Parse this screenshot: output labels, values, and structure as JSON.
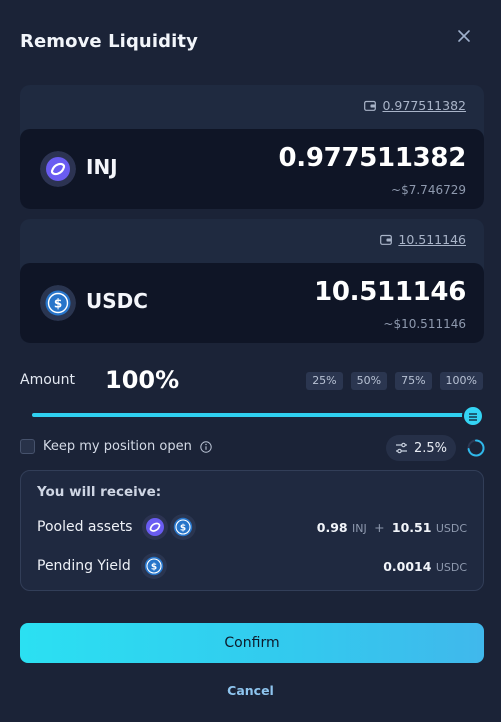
{
  "modal": {
    "title": "Remove Liquidity"
  },
  "tokens": [
    {
      "symbol": "INJ",
      "balance": "0.977511382",
      "amount": "0.977511382",
      "usd_value": "~$7.746729",
      "icon": "injective-logo-icon"
    },
    {
      "symbol": "USDC",
      "balance": "10.511146",
      "amount": "10.511146",
      "usd_value": "~$10.511146",
      "icon": "usdc-logo-icon"
    }
  ],
  "amount": {
    "label": "Amount",
    "value": "100%",
    "percent": 100,
    "presets": [
      "25%",
      "50%",
      "75%",
      "100%"
    ]
  },
  "options": {
    "keep_position_label": "Keep my position open",
    "keep_position_checked": false,
    "slippage": "2.5%"
  },
  "receive": {
    "title": "You will receive:",
    "pooled_label": "Pooled assets",
    "pooled_inj_amount": "0.98",
    "pooled_inj_unit": "INJ",
    "plus": "+",
    "pooled_usdc_amount": "10.51",
    "pooled_usdc_unit": "USDC",
    "pending_label": "Pending Yield",
    "pending_amount": "0.0014",
    "pending_unit": "USDC"
  },
  "actions": {
    "confirm_label": "Confirm",
    "cancel_label": "Cancel"
  },
  "colors": {
    "accent": "#2fd0f0",
    "background": "#1b2337",
    "inj_brand": "#5b63f0",
    "usdc_brand": "#2775ca"
  }
}
